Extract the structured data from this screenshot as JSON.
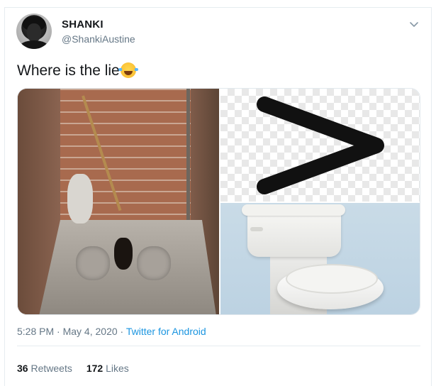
{
  "user": {
    "name": "SHANKI",
    "handle": "@ShankiAustine"
  },
  "tweet": {
    "text": "Where is the lie",
    "emoji": "face-with-tears-of-joy",
    "media": [
      {
        "icon": "pit-latrine-photo"
      },
      {
        "icon": "greater-than-sign-image"
      },
      {
        "icon": "flush-toilet-photo"
      }
    ]
  },
  "meta": {
    "time": "5:28 PM",
    "sep1": " · ",
    "date": "May 4, 2020",
    "sep2": " · ",
    "source": "Twitter for Android"
  },
  "stats": {
    "retweets_count": "36",
    "retweets_label": "Retweets",
    "likes_count": "172",
    "likes_label": "Likes"
  },
  "colors": {
    "link": "#1b95e0",
    "secondary_text": "#657786",
    "primary_text": "#14171a",
    "border": "#e6ecf0"
  }
}
